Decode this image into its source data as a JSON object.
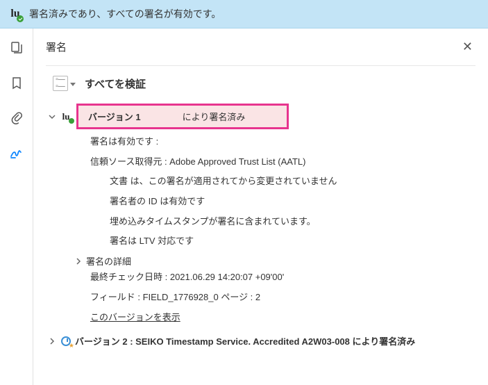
{
  "banner": {
    "text": "署名済みであり、すべての署名が有効です。"
  },
  "panel": {
    "title": "署名",
    "verify_all": "すべてを検証"
  },
  "v1": {
    "label": "バージョン 1",
    "signed_by": "により署名済み",
    "valid": "署名は有効です :",
    "trust_source": "信頼ソース取得元 : Adobe Approved Trust List (AATL)",
    "not_modified": "文書 は、この署名が適用されてから変更されていません",
    "id_valid": "署名者の ID は有効です",
    "embedded_ts": "埋め込みタイムスタンプが署名に含まれています。",
    "ltv": "署名は LTV 対応です",
    "details_label": "署名の詳細",
    "last_checked": "最終チェック日時 : 2021.06.29 14:20:07 +09'00'",
    "field": "フィールド : FIELD_1776928_0  ページ : 2",
    "show_version": "このバージョンを表示"
  },
  "v2": {
    "text": "バージョン 2 : SEIKO Timestamp Service. Accredited A2W03-008 により署名済み"
  }
}
